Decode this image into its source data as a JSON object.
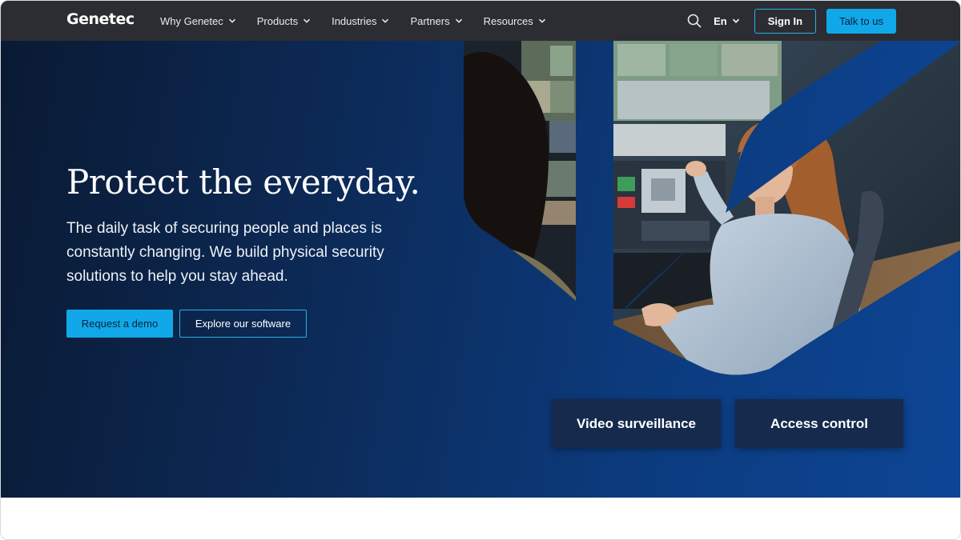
{
  "nav": {
    "logo": "Genetec",
    "menu": [
      {
        "label": "Why Genetec"
      },
      {
        "label": "Products"
      },
      {
        "label": "Industries"
      },
      {
        "label": "Partners"
      },
      {
        "label": "Resources"
      }
    ],
    "language": "En",
    "sign_in": "Sign In",
    "talk": "Talk to us"
  },
  "hero": {
    "title": "Protect the everyday.",
    "subtitle": "The daily task of securing people and places is constantly changing. We build physical security solutions to help you stay ahead.",
    "demo_button": "Request a demo",
    "explore_button": "Explore our software"
  },
  "cards": {
    "video": "Video surveillance",
    "access": "Access control"
  },
  "colors": {
    "nav_bg": "#2b2d33",
    "accent": "#10a8e8",
    "hero_dark": "#0a1a33",
    "hero_blue": "#0d4595",
    "card_bg": "#152a4d"
  }
}
